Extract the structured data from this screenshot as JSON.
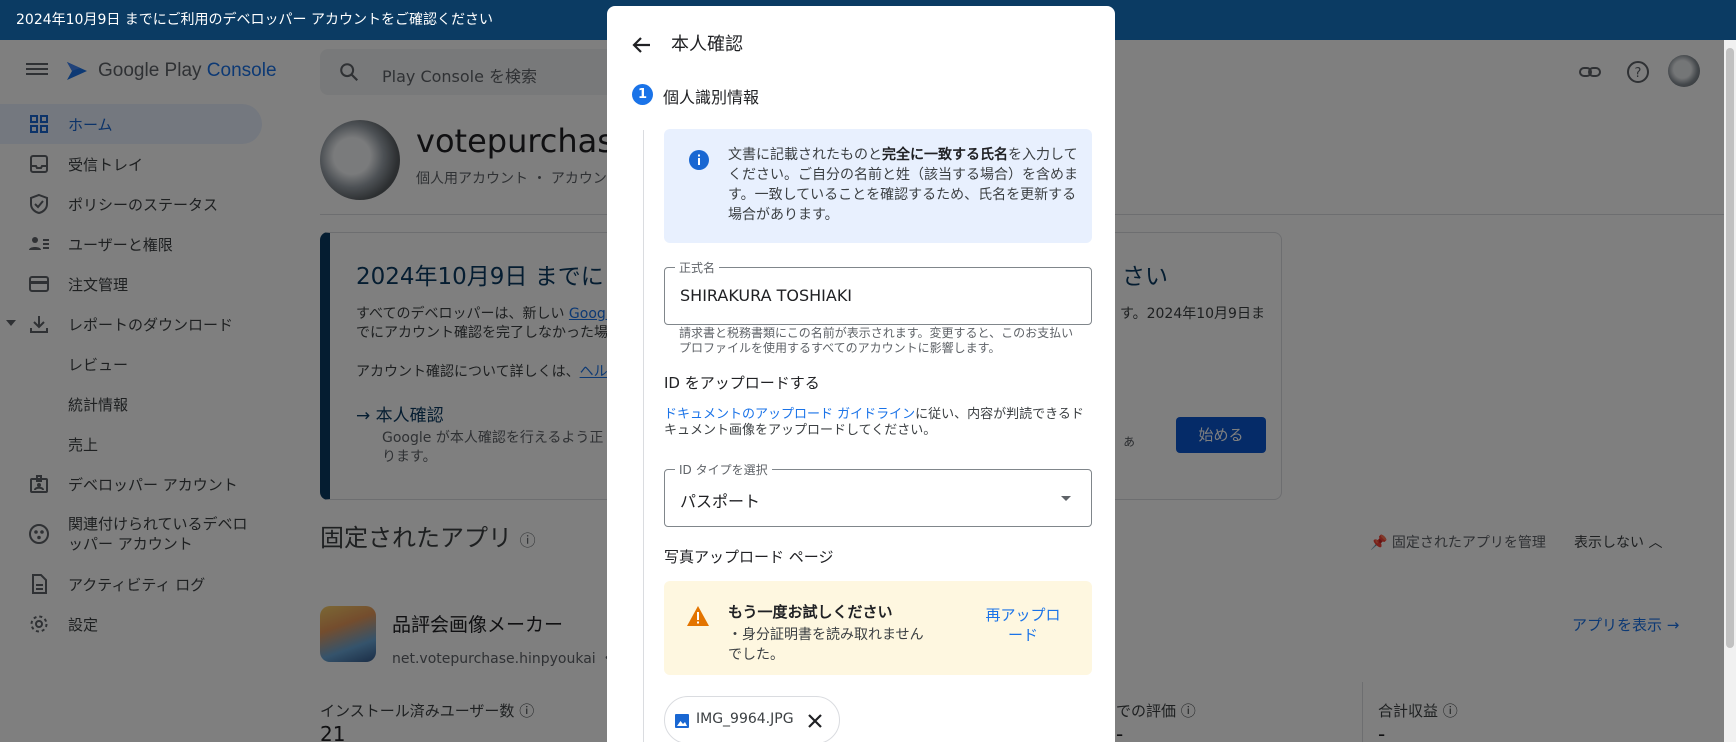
{
  "banner": {
    "text": "2024年10月9日 までにご利用のデベロッパー アカウントをご確認ください"
  },
  "header": {
    "logo_text_main": "Google Play",
    "logo_text_accent": "Console",
    "search_placeholder": "Play Console を検索"
  },
  "sidebar": {
    "items": [
      {
        "label": "ホーム",
        "icon": "grid-icon"
      },
      {
        "label": "受信トレイ",
        "icon": "inbox-icon"
      },
      {
        "label": "ポリシーのステータス",
        "icon": "shield-icon"
      },
      {
        "label": "ユーザーと権限",
        "icon": "users-icon"
      },
      {
        "label": "注文管理",
        "icon": "credit-card-icon"
      },
      {
        "label": "レポートのダウンロード",
        "icon": "download-icon"
      },
      {
        "label": "レビュー"
      },
      {
        "label": "統計情報"
      },
      {
        "label": "売上"
      },
      {
        "label": "デベロッパー アカウント",
        "icon": "badge-icon"
      },
      {
        "label": "関連付けられているデベロッパー アカウント",
        "icon": "linked-accounts-icon"
      },
      {
        "label": "アクティビティ ログ",
        "icon": "document-icon"
      },
      {
        "label": "設定",
        "icon": "gear-icon"
      }
    ]
  },
  "main": {
    "dev_name": "votepurchase",
    "dev_sub": "個人用アカウント ・ アカウン",
    "card": {
      "title": "2024年10月9日 までにこ",
      "title_right": "さい",
      "p1_start": "すべてのデベロッパーは、新しい ",
      "p1_link": "Googl",
      "p1_line2": "でにアカウント確認を完了しなかった場",
      "p1_right": "す。2024年10月9日ま",
      "p2_start": "アカウント確認について詳しくは、",
      "p2_link": "ヘル",
      "verify_title": "本人確認",
      "verify_desc": "Google が本人確認を行えるよう正 ります。",
      "verify_right": "ぁ",
      "start_button": "始める"
    },
    "pinned": {
      "title": "固定されたアプリ",
      "manage": "固定されたアプリを管理",
      "hide": "表示しない"
    },
    "app": {
      "name": "品評会画像メーカー",
      "package": "net.votepurchase.hinpyoukai ・ 最",
      "view": "アプリを表示"
    },
    "stats": {
      "installs_label": "インストール済みユーザー数",
      "installs_value": "21",
      "rating_label": "での評価",
      "rating_value": "-",
      "revenue_label": "合計収益",
      "revenue_value": "-"
    }
  },
  "dialog": {
    "title": "本人確認",
    "step_number": "1",
    "step_label": "個人識別情報",
    "info_pre": "文書に記載されたものと",
    "info_bold": "完全に一致する氏名",
    "info_post": "を入力してください。ご自分の名前と姓（該当する場合）を含めます。一致していることを確認するため、氏名を更新する場合があります。",
    "name_label": "正式名",
    "name_value": "SHIRAKURA TOSHIAKI",
    "name_helper": "請求書と税務書類にこの名前が表示されます。変更すると、このお支払いプロファイルを使用するすべてのアカウントに影響します。",
    "upload_title": "ID をアップロードする",
    "upload_link": "ドキュメントのアップロード ガイドライン",
    "upload_text": "に従い、内容が判読できるドキュメント画像をアップロードしてください。",
    "id_type_label": "ID タイプを選択",
    "id_type_value": "パスポート",
    "photo_page_title": "写真アップロード ページ",
    "warn_title": "もう一度お試しください",
    "warn_message": "・身分証明書を読み取れませんでした。",
    "reupload": "再アップロード",
    "file_name": "IMG_9964.JPG"
  },
  "colors": {
    "banner": "#0b3b63",
    "accent": "#1a73e8",
    "primary_button": "#0b57d0",
    "info_bg": "#e8f0fe",
    "warning_bg": "#fef7e0",
    "warning_icon": "#e37400"
  }
}
